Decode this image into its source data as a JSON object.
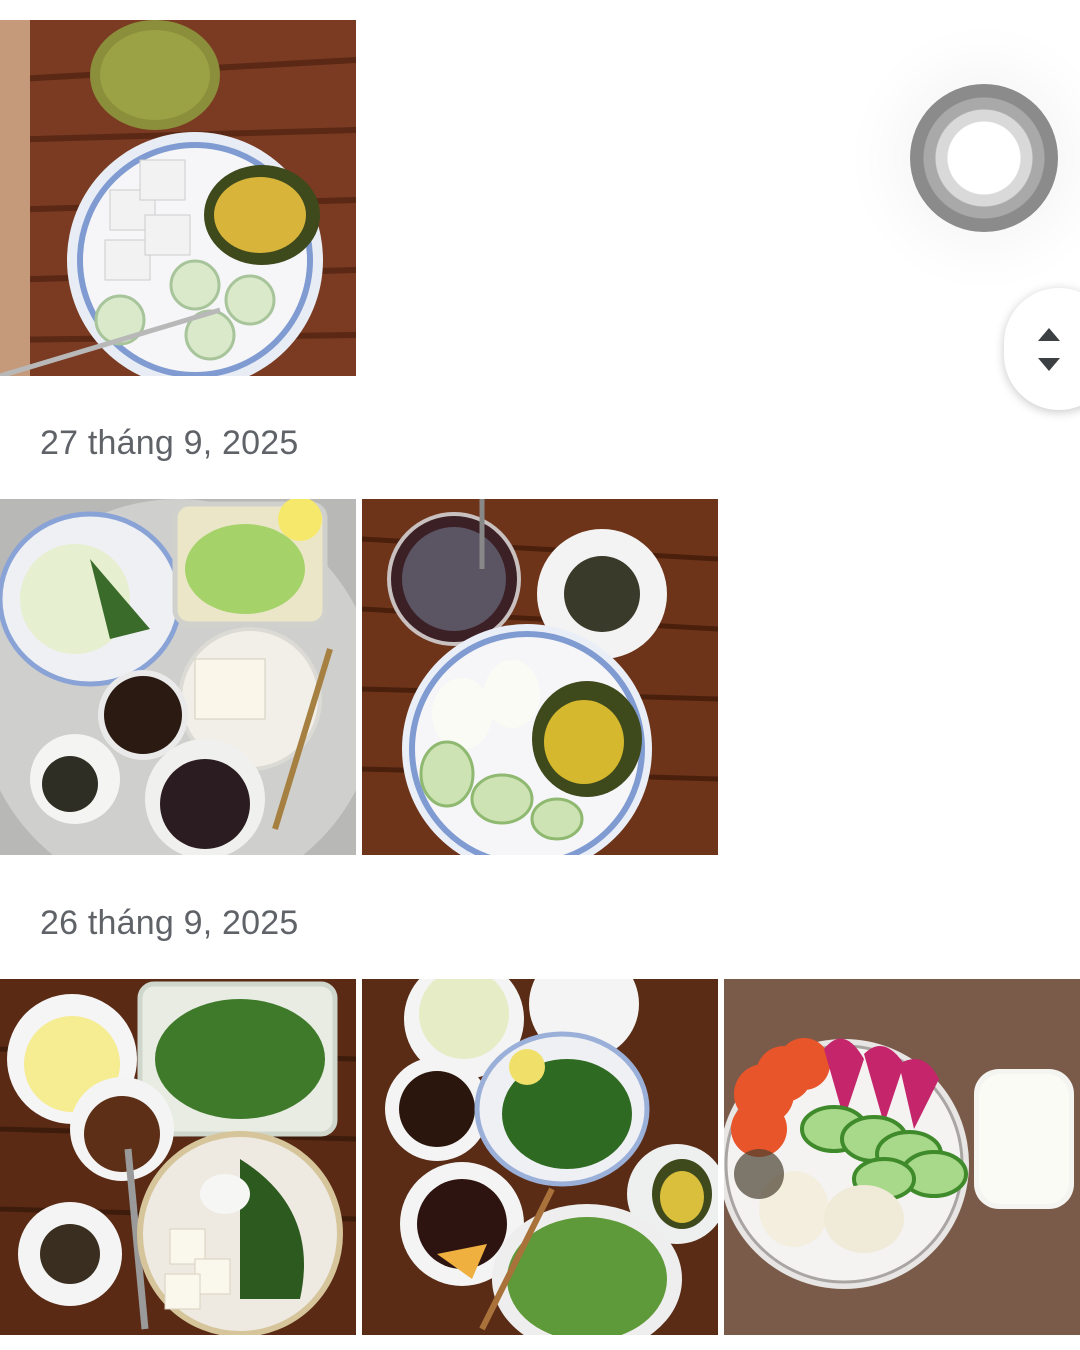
{
  "sections": [
    {
      "date": "27 tháng 9, 2025"
    },
    {
      "date": "26 tháng 9, 2025"
    }
  ],
  "photos": [
    {
      "section": "previous",
      "subject": "dragon fruit, avocado and cucumber plate with green drink"
    },
    {
      "section": "27 tháng 9, 2025",
      "subject": "tray with cabbage, vegetables, tofu, dipping sauce and sesame"
    },
    {
      "section": "27 tháng 9, 2025",
      "subject": "chia drink, boiled eggs, avocado and cucumber"
    },
    {
      "section": "26 tháng 9, 2025",
      "subject": "greens, tofu, soup bowl and sesame salt"
    },
    {
      "section": "26 tháng 9, 2025",
      "subject": "greens, sauce, beans, avocado and bitter melon"
    },
    {
      "section": "26 tháng 9, 2025",
      "subject": "tomato, dragon fruit, cucumber, eggs and milk"
    }
  ],
  "controls": {
    "assistant_icon": "assistive-touch-icon",
    "scroll_icon": "fast-scroll-handle-icon"
  },
  "colors": {
    "date_text": "#5f6368",
    "background": "#ffffff"
  }
}
